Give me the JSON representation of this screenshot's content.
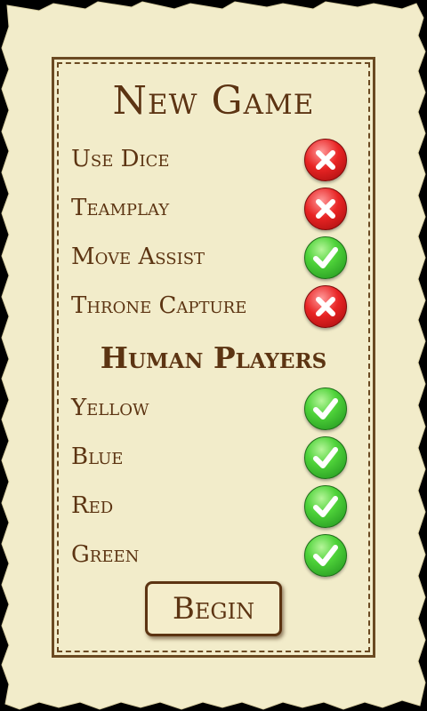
{
  "colors": {
    "background": "#000000",
    "parchment": "#f2ecca",
    "ink": "#5c3412",
    "toggle_on": "#3cc52c",
    "toggle_off": "#e02222"
  },
  "title": "New Game",
  "options": [
    {
      "label": "Use Dice",
      "state": "off",
      "icon": "x-icon"
    },
    {
      "label": "Teamplay",
      "state": "off",
      "icon": "x-icon"
    },
    {
      "label": "Move Assist",
      "state": "on",
      "icon": "checkmark-icon"
    },
    {
      "label": "Throne Capture",
      "state": "off",
      "icon": "x-icon"
    }
  ],
  "players_heading": "Human Players",
  "players": [
    {
      "label": "Yellow",
      "state": "on",
      "icon": "checkmark-icon"
    },
    {
      "label": "Blue",
      "state": "on",
      "icon": "checkmark-icon"
    },
    {
      "label": "Red",
      "state": "on",
      "icon": "checkmark-icon"
    },
    {
      "label": "Green",
      "state": "on",
      "icon": "checkmark-icon"
    }
  ],
  "begin_label": "Begin"
}
